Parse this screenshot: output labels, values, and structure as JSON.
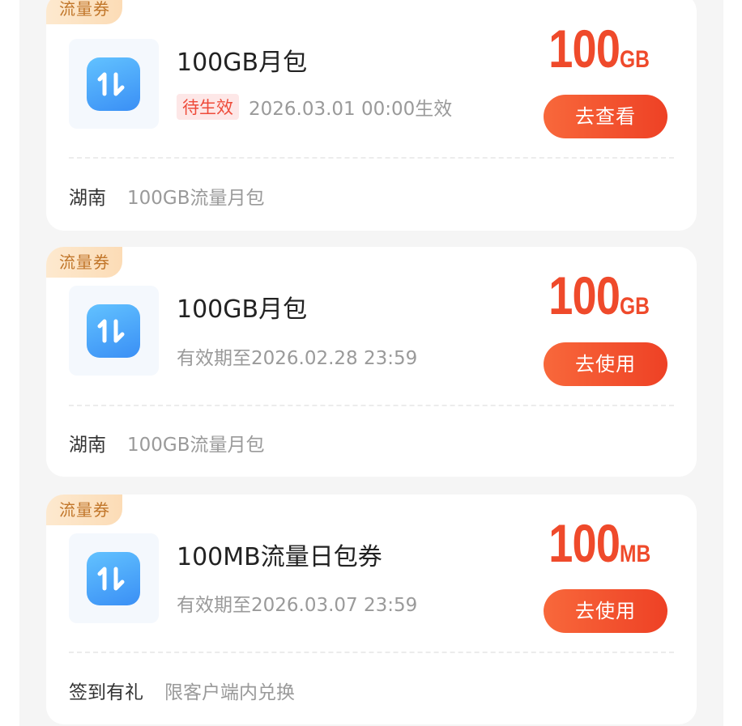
{
  "cards": [
    {
      "tag": "流量券",
      "title": "100GB月包",
      "status_badge": "待生效",
      "validity": "2026.03.01 00:00生效",
      "amount_value": "100",
      "amount_unit": "GB",
      "button_label": "去查看",
      "footer_region": "湖南",
      "footer_desc": "100GB流量月包",
      "icon": "data-transfer-icon"
    },
    {
      "tag": "流量券",
      "title": "100GB月包",
      "validity": "有效期至2026.02.28 23:59",
      "amount_value": "100",
      "amount_unit": "GB",
      "button_label": "去使用",
      "footer_region": "湖南",
      "footer_desc": "100GB流量月包",
      "icon": "data-transfer-icon"
    },
    {
      "tag": "流量券",
      "title": "100MB流量日包券",
      "validity": "有效期至2026.03.07 23:59",
      "amount_value": "100",
      "amount_unit": "MB",
      "button_label": "去使用",
      "footer_region": "签到有礼",
      "footer_desc": "限客户端内兑换",
      "icon": "data-transfer-icon"
    }
  ],
  "colors": {
    "accent": "#ef4a2b",
    "tag_text": "#c1762a",
    "tag_bg": "#fde9cf",
    "icon_blue": "#3a8ff5",
    "badge_bg": "#fde7e7"
  }
}
